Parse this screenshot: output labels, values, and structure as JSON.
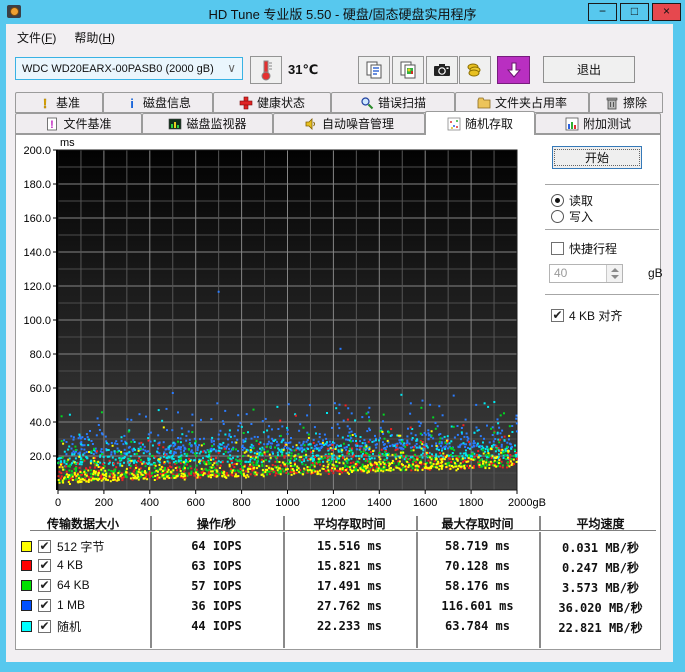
{
  "window": {
    "title": "HD Tune 专业版 5.50 - 硬盘/固态硬盘实用程序",
    "minimize": "−",
    "maximize": "□",
    "close": "×"
  },
  "menu": {
    "items": [
      {
        "name": "file",
        "label": "文件(F)"
      },
      {
        "name": "help",
        "label": "帮助(H)"
      }
    ]
  },
  "toolbar": {
    "drive_select": "WDC WD20EARX-00PASB0 (2000 gB)",
    "chevron": "∨",
    "temperature": "31℃",
    "exit_label": "退出",
    "icons": [
      "thermometer-icon",
      "copy-text-icon",
      "copy-image-icon",
      "camera-icon",
      "coins-icon",
      "update-arrow-icon"
    ]
  },
  "tabs": {
    "row1": [
      {
        "name": "benchmark",
        "label": "基准",
        "icon": "benchmark-icon",
        "active": false
      },
      {
        "name": "disk-info",
        "label": "磁盘信息",
        "icon": "info-icon",
        "active": false
      },
      {
        "name": "health",
        "label": "健康状态",
        "icon": "health-icon",
        "active": false
      },
      {
        "name": "error-scan",
        "label": "错误扫描",
        "icon": "scan-icon",
        "active": false
      },
      {
        "name": "folder-usage",
        "label": "文件夹占用率",
        "icon": "folder-icon",
        "active": false
      },
      {
        "name": "erase",
        "label": "擦除",
        "icon": "erase-icon",
        "active": false
      }
    ],
    "row2": [
      {
        "name": "file-benchmark",
        "label": "文件基准",
        "icon": "file-benchmark-icon",
        "active": false
      },
      {
        "name": "disk-monitor",
        "label": "磁盘监视器",
        "icon": "monitor-icon",
        "active": false
      },
      {
        "name": "aam",
        "label": "自动噪音管理",
        "icon": "speaker-icon",
        "active": false
      },
      {
        "name": "random-access",
        "label": "随机存取",
        "icon": "scatter-icon",
        "active": true
      },
      {
        "name": "extra-tests",
        "label": "附加测试",
        "icon": "extra-tests-icon",
        "active": false
      }
    ]
  },
  "controls": {
    "start_label": "开始",
    "read_label": "读取",
    "write_label": "写入",
    "read_selected": true,
    "write_selected": false,
    "short_stroke_label": "快捷行程",
    "short_stroke_checked": false,
    "capacity_value": "40",
    "capacity_unit": "gB",
    "align_label": "4 KB 对齐",
    "align_checked": true,
    "check_glyph": "✔"
  },
  "chart_data": {
    "type": "scatter",
    "title": "随机存取 access time scatter",
    "xlabel_unit": "gB",
    "ylabel_unit": "ms",
    "xlim": [
      0,
      2000
    ],
    "ylim": [
      0,
      200
    ],
    "x_major_ticks": [
      0,
      200,
      400,
      600,
      800,
      1000,
      1200,
      1400,
      1600,
      1800,
      2000
    ],
    "x_minor_step": 100,
    "y_major_ticks": [
      20,
      40,
      60,
      80,
      100,
      120,
      140,
      160,
      180,
      200
    ],
    "y_minor_step": 10,
    "grid": true,
    "seed": 20130507,
    "series": [
      {
        "name": "512 字节",
        "color": "#ffff00",
        "iops": 64,
        "avg_ms": 15.516,
        "max_ms": 58.719,
        "speed_mbs": 0.031,
        "points_count": 560,
        "floor_start": 3.2,
        "floor_end": 12.5,
        "tail_mean": 5.0,
        "cap_ms": 38
      },
      {
        "name": "4 KB",
        "color": "#f32222",
        "iops": 63,
        "avg_ms": 15.821,
        "max_ms": 70.128,
        "speed_mbs": 0.247,
        "points_count": 560,
        "floor_start": 4.0,
        "floor_end": 13.0,
        "tail_mean": 5.2,
        "cap_ms": 42
      },
      {
        "name": "64 KB",
        "color": "#00d822",
        "iops": 57,
        "avg_ms": 17.491,
        "max_ms": 58.176,
        "speed_mbs": 3.573,
        "points_count": 560,
        "floor_start": 4.5,
        "floor_end": 13.5,
        "tail_mean": 5.8,
        "cap_ms": 40
      },
      {
        "name": "1 MB",
        "color": "#2a7cff",
        "iops": 36,
        "avg_ms": 27.762,
        "max_ms": 116.601,
        "speed_mbs": 36.02,
        "points_count": 560,
        "floor_start": 19.5,
        "floor_end": 24.5,
        "tail_mean": 6.0,
        "cap_ms": 50
      },
      {
        "name": "随机",
        "color": "#00e8f0",
        "iops": 44,
        "avg_ms": 22.233,
        "max_ms": 63.784,
        "speed_mbs": 22.821,
        "points_count": 560,
        "floor_start": 13.5,
        "floor_end": 18.0,
        "tail_mean": 5.0,
        "cap_ms": 42
      }
    ],
    "outliers": [
      {
        "series": "1 MB",
        "x_gb": 700,
        "y_ms": 116.601
      }
    ]
  },
  "table": {
    "headers": [
      "传输数据大小",
      "操作/秒",
      "平均存取时间",
      "最大存取时间",
      "平均速度"
    ],
    "rows": [
      {
        "swatch": "#ffff00",
        "checked": true,
        "label": "512 字节",
        "iops": "64 IOPS",
        "avg": "15.516 ms",
        "max": "58.719 ms",
        "speed": "0.031 MB/秒"
      },
      {
        "swatch": "#ff0000",
        "checked": true,
        "label": "4 KB",
        "iops": "63 IOPS",
        "avg": "15.821 ms",
        "max": "70.128 ms",
        "speed": "0.247 MB/秒"
      },
      {
        "swatch": "#00e000",
        "checked": true,
        "label": "64 KB",
        "iops": "57 IOPS",
        "avg": "17.491 ms",
        "max": "58.176 ms",
        "speed": "3.573 MB/秒"
      },
      {
        "swatch": "#0050ff",
        "checked": true,
        "label": "1 MB",
        "iops": "36 IOPS",
        "avg": "27.762 ms",
        "max": "116.601 ms",
        "speed": "36.020 MB/秒"
      },
      {
        "swatch": "#00ffff",
        "checked": true,
        "label": "随机",
        "iops": "44 IOPS",
        "avg": "22.233 ms",
        "max": "63.784 ms",
        "speed": "22.821 MB/秒"
      }
    ]
  }
}
